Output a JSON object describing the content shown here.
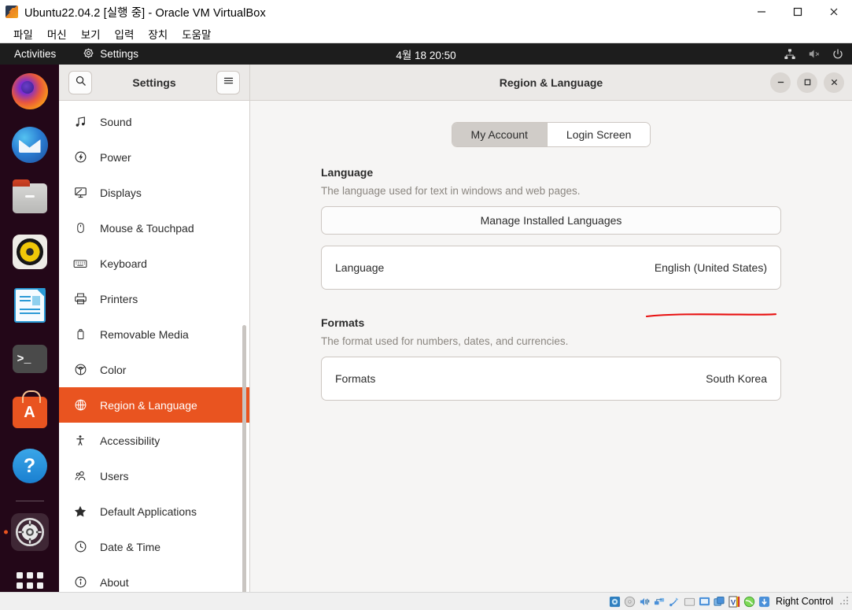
{
  "vbox": {
    "title": "Ubuntu22.04.2 [실행 중] - Oracle VM VirtualBox",
    "app_icon": "virtualbox-icon",
    "menus": [
      "파일",
      "머신",
      "보기",
      "입력",
      "장치",
      "도움말"
    ],
    "window_buttons": {
      "minimize": "—",
      "maximize": "□",
      "close": "✕"
    },
    "statusbar": {
      "host_key": "Right Control",
      "icons": [
        "harddisk-icon",
        "optical-disk-icon",
        "audio-icon",
        "network-icon",
        "usb-icon",
        "shared-folder-icon",
        "display-icon",
        "recording-icon",
        "vm-features-icon",
        "globe-icon",
        "mouse-capture-icon"
      ]
    }
  },
  "gnome": {
    "activities": "Activities",
    "app_name": "Settings",
    "app_icon": "gear-icon",
    "clock": "4월 18  20:50",
    "tray": [
      "network-wired-icon",
      "volume-muted-icon",
      "power-icon"
    ]
  },
  "dock": {
    "items": [
      {
        "name": "firefox",
        "label": "Firefox",
        "running": false
      },
      {
        "name": "thunderbird",
        "label": "Thunderbird Mail",
        "running": false
      },
      {
        "name": "files",
        "label": "Files",
        "running": false
      },
      {
        "name": "rhythmbox",
        "label": "Rhythmbox",
        "running": false
      },
      {
        "name": "writer",
        "label": "LibreOffice Writer",
        "running": false
      },
      {
        "name": "terminal",
        "label": "Terminal",
        "running": false
      },
      {
        "name": "software",
        "label": "Ubuntu Software",
        "running": false
      },
      {
        "name": "help",
        "label": "Help",
        "running": false
      },
      {
        "name": "settings",
        "label": "Settings",
        "running": true
      }
    ],
    "show_applications": "Show Applications"
  },
  "settings_window": {
    "sidebar_title": "Settings",
    "panel_title": "Region & Language",
    "search_icon": "search-icon",
    "menu_icon": "hamburger-menu-icon",
    "window_controls": {
      "minimize": "minimize-icon",
      "maximize": "maximize-icon",
      "close": "close-icon"
    }
  },
  "sidebar": {
    "items": [
      {
        "label": "Sound",
        "icon": "music-note-icon",
        "selected": false
      },
      {
        "label": "Power",
        "icon": "power-circle-icon",
        "selected": false
      },
      {
        "label": "Displays",
        "icon": "monitor-icon",
        "selected": false
      },
      {
        "label": "Mouse & Touchpad",
        "icon": "mouse-icon",
        "selected": false
      },
      {
        "label": "Keyboard",
        "icon": "keyboard-icon",
        "selected": false
      },
      {
        "label": "Printers",
        "icon": "printer-icon",
        "selected": false
      },
      {
        "label": "Removable Media",
        "icon": "usb-drive-icon",
        "selected": false
      },
      {
        "label": "Color",
        "icon": "color-wheel-icon",
        "selected": false
      },
      {
        "label": "Region & Language",
        "icon": "globe-icon",
        "selected": true
      },
      {
        "label": "Accessibility",
        "icon": "accessibility-person-icon",
        "selected": false
      },
      {
        "label": "Users",
        "icon": "users-icon",
        "selected": false
      },
      {
        "label": "Default Applications",
        "icon": "star-icon",
        "selected": false
      },
      {
        "label": "Date & Time",
        "icon": "clock-icon",
        "selected": false
      },
      {
        "label": "About",
        "icon": "info-circle-icon",
        "selected": false
      }
    ]
  },
  "content": {
    "tabs": [
      {
        "label": "My Account",
        "active": true
      },
      {
        "label": "Login Screen",
        "active": false
      }
    ],
    "language_section": {
      "title": "Language",
      "description": "The language used for text in windows and web pages.",
      "manage_button": "Manage Installed Languages",
      "row_label": "Language",
      "row_value": "English (United States)"
    },
    "formats_section": {
      "title": "Formats",
      "description": "The format used for numbers, dates, and currencies.",
      "row_label": "Formats",
      "row_value": "South Korea"
    },
    "annotation": {
      "type": "red-underline",
      "color": "#e81010",
      "target": "English (United States)"
    }
  },
  "colors": {
    "ubuntu_orange": "#e95420",
    "sidebar_bg": "#ffffff",
    "content_bg": "#f6f5f4",
    "headerbar_bg": "#ebe9e7",
    "topbar_bg": "#1d1d1d",
    "annotation_red": "#e81010"
  }
}
